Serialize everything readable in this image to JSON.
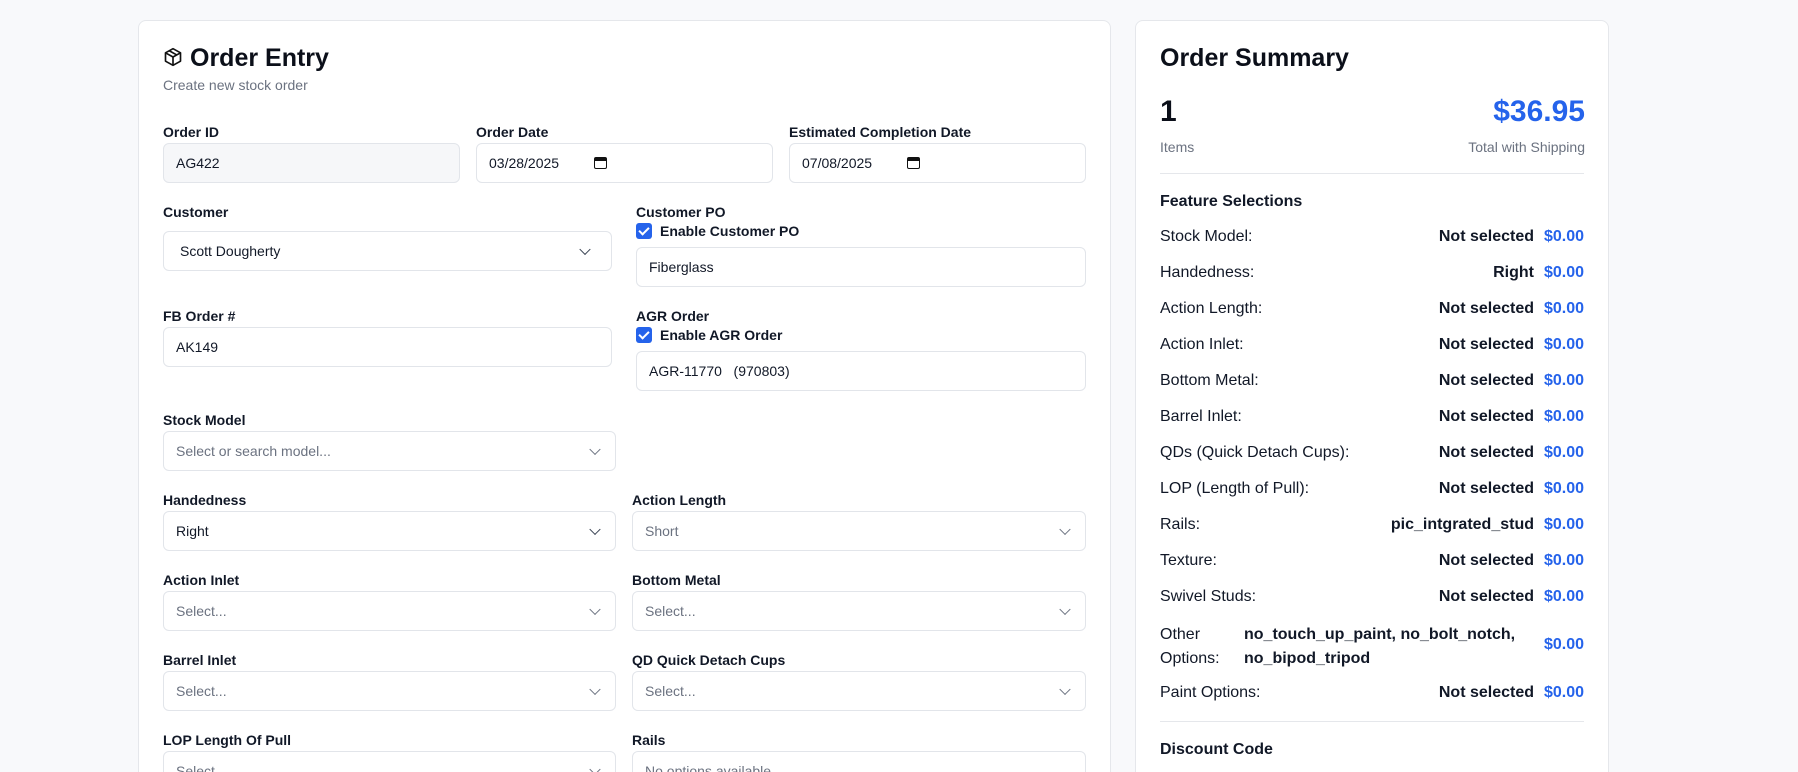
{
  "order_entry": {
    "title": "Order Entry",
    "subtitle": "Create new stock order",
    "order_id": {
      "label": "Order ID",
      "value": "AG422"
    },
    "order_date": {
      "label": "Order Date",
      "value": "03/28/2025"
    },
    "completion_date": {
      "label": "Estimated Completion Date",
      "value": "07/08/2025"
    },
    "customer": {
      "label": "Customer",
      "value": "Scott Dougherty"
    },
    "customer_po": {
      "label": "Customer PO",
      "checkbox_label": "Enable Customer PO",
      "value": "Fiberglass"
    },
    "fb_order": {
      "label": "FB Order #",
      "value": "AK149"
    },
    "agr_order": {
      "label": "AGR Order",
      "checkbox_label": "Enable AGR Order",
      "value": "AGR-11770   (970803)"
    },
    "stock_model": {
      "label": "Stock Model",
      "placeholder": "Select or search model..."
    },
    "handedness": {
      "label": "Handedness",
      "value": "Right"
    },
    "action_length": {
      "label": "Action Length",
      "value": "Short"
    },
    "action_inlet": {
      "label": "Action Inlet",
      "placeholder": "Select..."
    },
    "bottom_metal": {
      "label": "Bottom Metal",
      "placeholder": "Select..."
    },
    "barrel_inlet": {
      "label": "Barrel Inlet",
      "placeholder": "Select..."
    },
    "qd_cups": {
      "label": "QD Quick Detach Cups",
      "placeholder": "Select..."
    },
    "lop": {
      "label": "LOP Length Of Pull",
      "placeholder": "Select..."
    },
    "rails": {
      "label": "Rails",
      "placeholder": "No options available"
    }
  },
  "summary": {
    "title": "Order Summary",
    "items_count": "1",
    "items_label": "Items",
    "total": "$36.95",
    "total_label": "Total with Shipping",
    "features_heading": "Feature Selections",
    "rows": [
      {
        "name": "Stock Model:",
        "value": "Not selected",
        "price": "$0.00"
      },
      {
        "name": "Handedness:",
        "value": "Right",
        "price": "$0.00"
      },
      {
        "name": "Action Length:",
        "value": "Not selected",
        "price": "$0.00"
      },
      {
        "name": "Action Inlet:",
        "value": "Not selected",
        "price": "$0.00"
      },
      {
        "name": "Bottom Metal:",
        "value": "Not selected",
        "price": "$0.00"
      },
      {
        "name": "Barrel Inlet:",
        "value": "Not selected",
        "price": "$0.00"
      },
      {
        "name": "QDs (Quick Detach Cups):",
        "value": "Not selected",
        "price": "$0.00"
      },
      {
        "name": "LOP (Length of Pull):",
        "value": "Not selected",
        "price": "$0.00"
      },
      {
        "name": "Rails:",
        "value": "pic_intgrated_stud",
        "price": "$0.00"
      },
      {
        "name": "Texture:",
        "value": "Not selected",
        "price": "$0.00"
      },
      {
        "name": "Swivel Studs:",
        "value": "Not selected",
        "price": "$0.00"
      }
    ],
    "other_options": {
      "name_line1": "Other",
      "name_line2": "Options:",
      "value_line1": "no_touch_up_paint, no_bolt_notch,",
      "value_line2": "no_bipod_tripod",
      "price": "$0.00"
    },
    "paint_options": {
      "name": "Paint Options:",
      "value": "Not selected",
      "price": "$0.00"
    },
    "discount_heading": "Discount Code"
  }
}
